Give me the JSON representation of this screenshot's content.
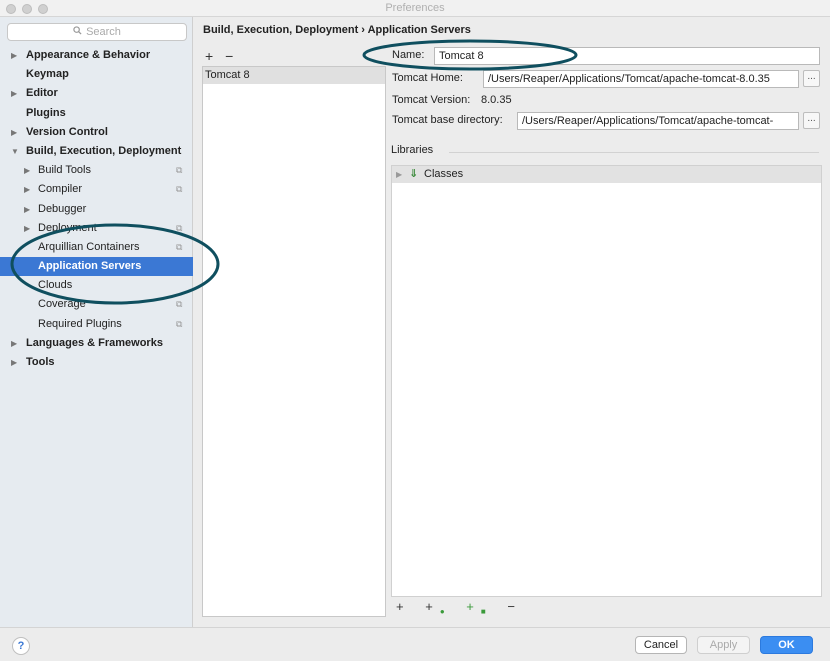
{
  "window": {
    "title": "Preferences"
  },
  "sidebar": {
    "search_placeholder": "Search",
    "items": [
      {
        "label": "Appearance & Behavior",
        "level": 0,
        "arrow": "▶",
        "bold": true
      },
      {
        "label": "Keymap",
        "level": 0,
        "arrow": "",
        "bold": true
      },
      {
        "label": "Editor",
        "level": 0,
        "arrow": "▶",
        "bold": true
      },
      {
        "label": "Plugins",
        "level": 0,
        "arrow": "",
        "bold": true
      },
      {
        "label": "Version Control",
        "level": 0,
        "arrow": "▶",
        "bold": true
      },
      {
        "label": "Build, Execution, Deployment",
        "level": 0,
        "arrow": "▼",
        "bold": true
      },
      {
        "label": "Build Tools",
        "level": 1,
        "arrow": "▶",
        "copy": true
      },
      {
        "label": "Compiler",
        "level": 1,
        "arrow": "▶",
        "copy": true
      },
      {
        "label": "Debugger",
        "level": 1,
        "arrow": "▶",
        "copy": false
      },
      {
        "label": "Deployment",
        "level": 1,
        "arrow": "▶",
        "copy": true
      },
      {
        "label": "Arquillian Containers",
        "level": 1,
        "arrow": "",
        "copy": true
      },
      {
        "label": "Application Servers",
        "level": 1,
        "arrow": "",
        "copy": false,
        "selected": true
      },
      {
        "label": "Clouds",
        "level": 1,
        "arrow": "",
        "copy": false
      },
      {
        "label": "Coverage",
        "level": 1,
        "arrow": "",
        "copy": true
      },
      {
        "label": "Required Plugins",
        "level": 1,
        "arrow": "",
        "copy": true
      },
      {
        "label": "Languages & Frameworks",
        "level": 0,
        "arrow": "▶",
        "bold": true
      },
      {
        "label": "Tools",
        "level": 0,
        "arrow": "▶",
        "bold": true
      }
    ]
  },
  "breadcrumb": "Build, Execution, Deployment › Application Servers",
  "server_list": {
    "add": "+",
    "remove": "−",
    "items": [
      "Tomcat 8"
    ]
  },
  "form": {
    "name_label": "Name:",
    "name_value": "Tomcat 8",
    "home_label": "Tomcat Home:",
    "home_value": "/Users/Reaper/Applications/Tomcat/apache-tomcat-8.0.35",
    "version_label": "Tomcat Version:",
    "version_value": "8.0.35",
    "base_label": "Tomcat base directory:",
    "base_value": "/Users/Reaper/Applications/Tomcat/apache-tomcat-",
    "browse": "..."
  },
  "libraries": {
    "label": "Libraries",
    "rows": [
      "Classes"
    ],
    "tools": [
      "+",
      "+",
      "+",
      "−"
    ]
  },
  "buttons": {
    "help": "?",
    "cancel": "Cancel",
    "apply": "Apply",
    "ok": "OK"
  },
  "colors": {
    "selection": "#3b78d4",
    "annotation_ring": "#0f4f5f",
    "primary_button": "#3b8ef2"
  }
}
